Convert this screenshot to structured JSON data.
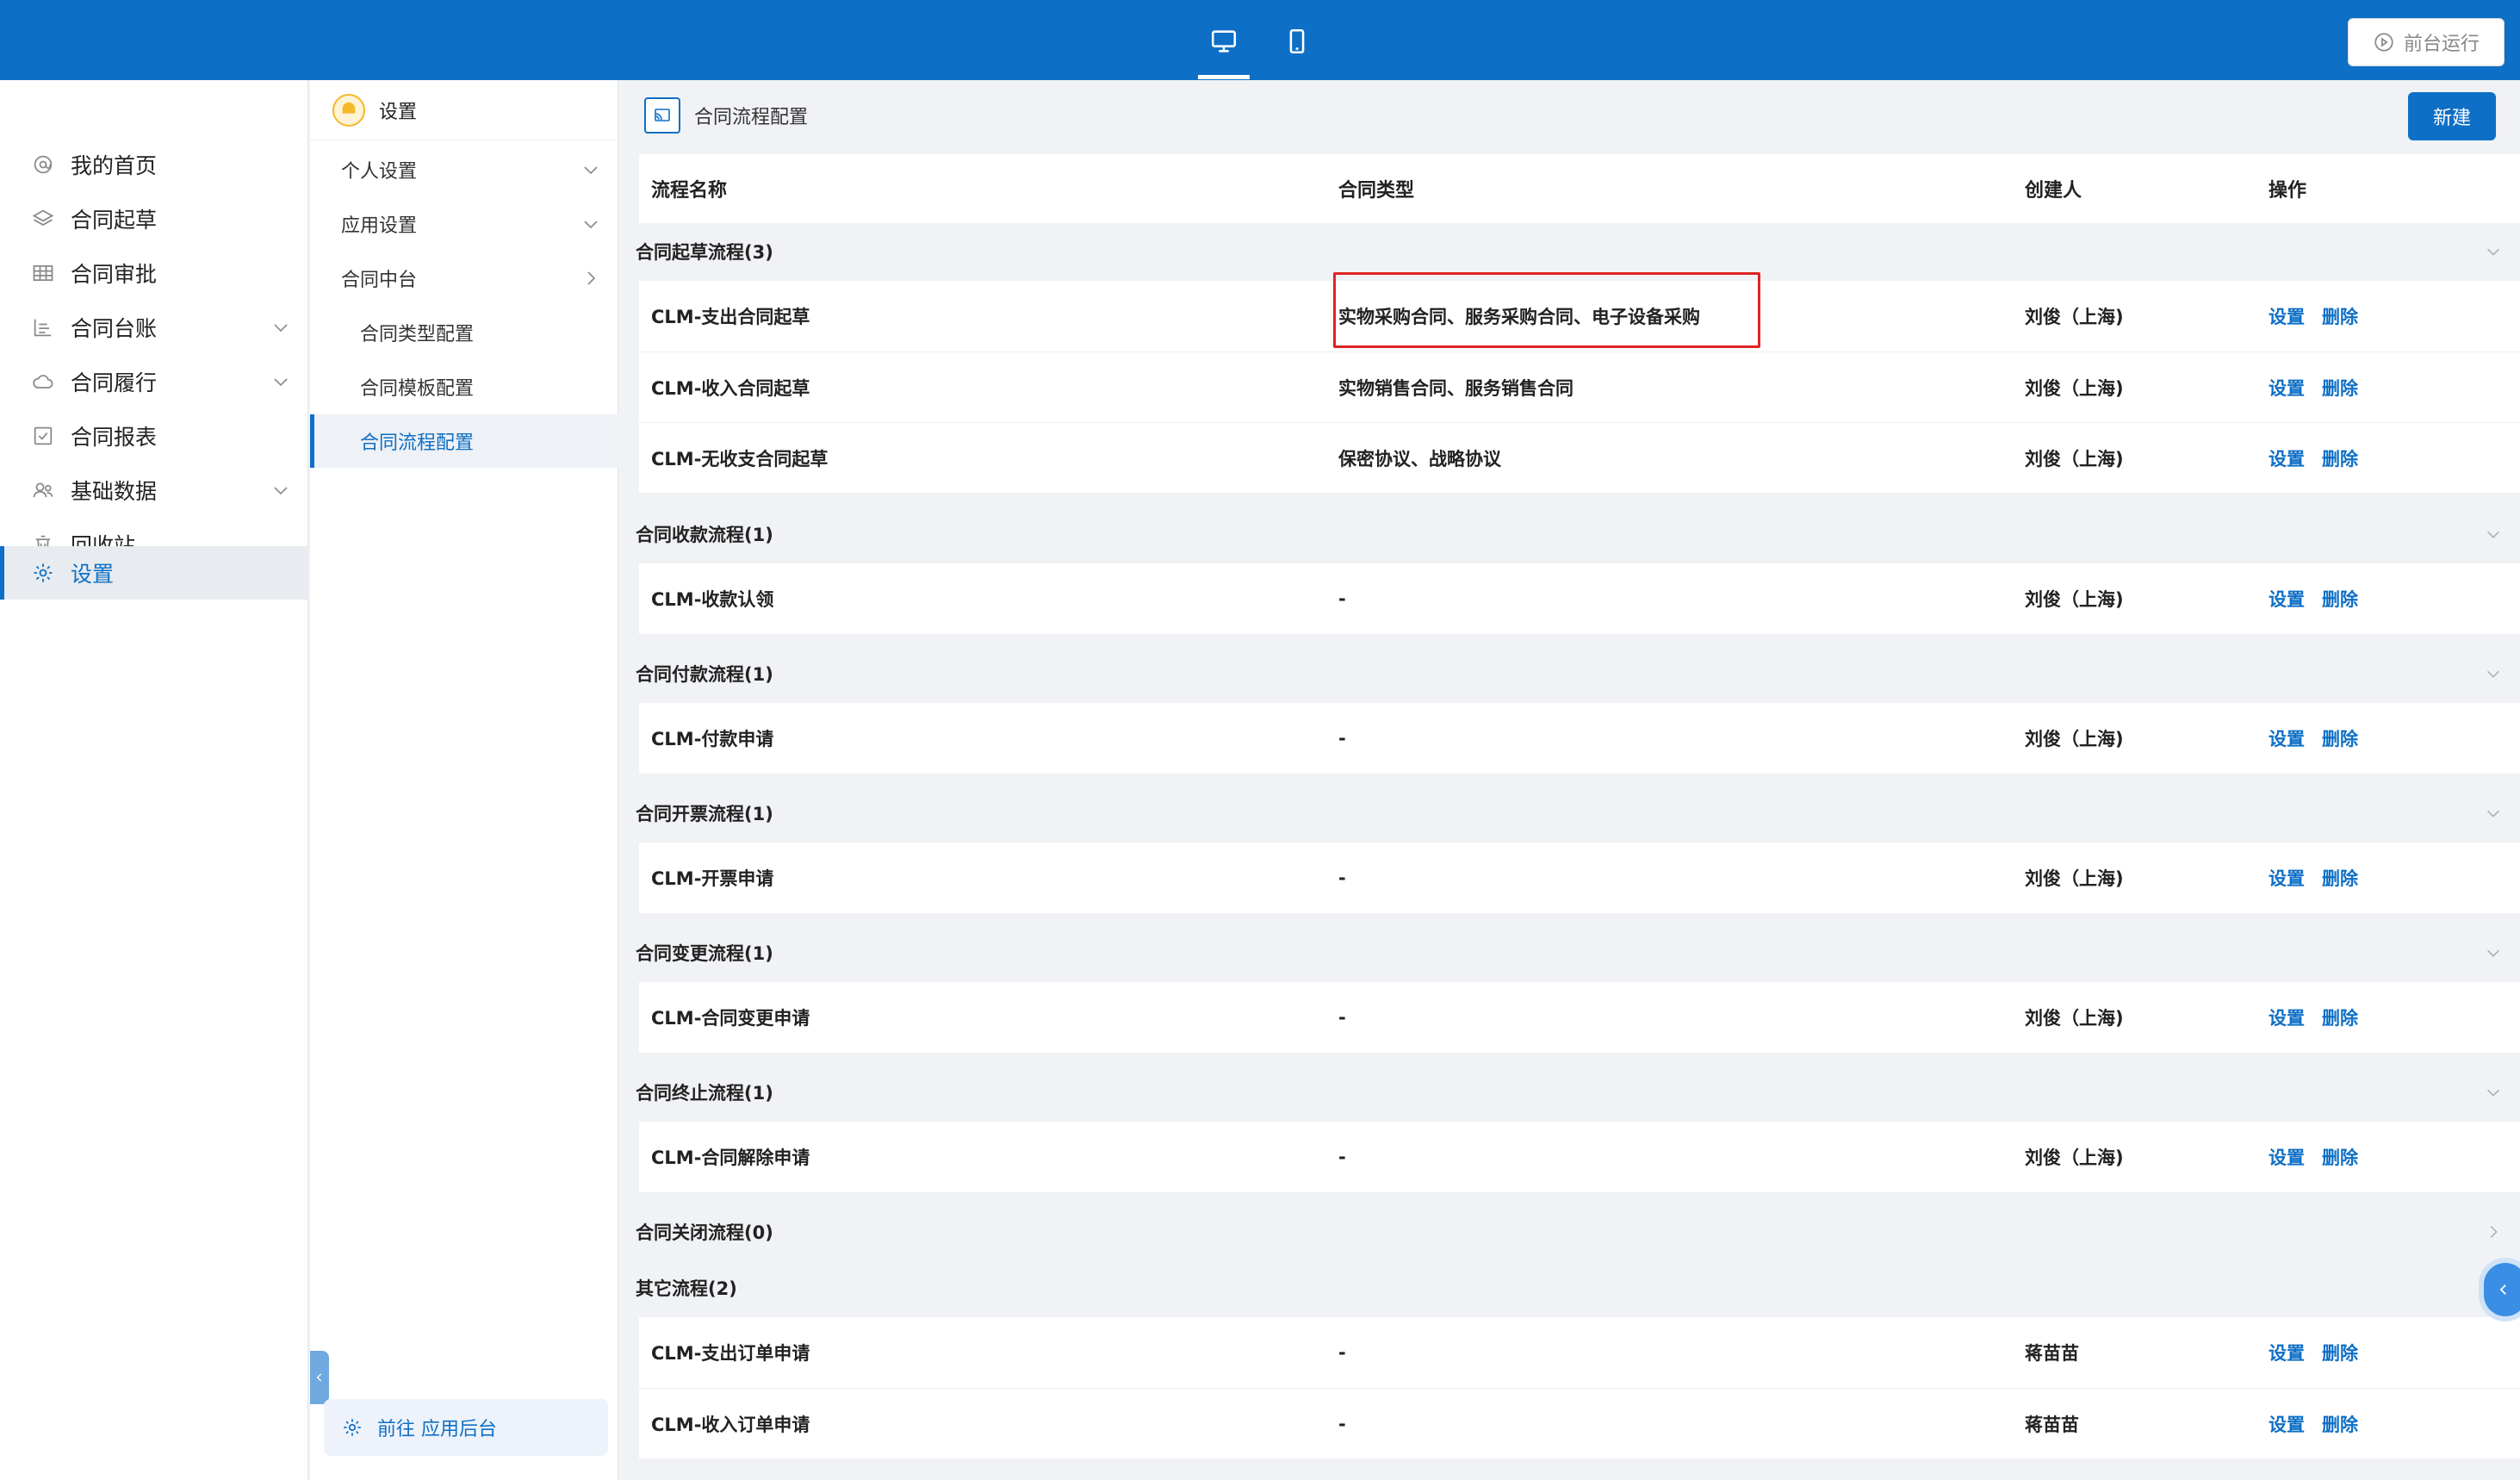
{
  "topbar": {
    "run_label": "前台运行",
    "device_desktop": "desktop-icon",
    "device_mobile": "mobile-icon"
  },
  "leftnav": {
    "items": [
      {
        "label": "我的首页",
        "icon": "at-icon"
      },
      {
        "label": "合同起草",
        "icon": "layers-icon"
      },
      {
        "label": "合同审批",
        "icon": "table-icon"
      },
      {
        "label": "合同台账",
        "icon": "list-icon"
      },
      {
        "label": "合同履行",
        "icon": "cloud-icon"
      },
      {
        "label": "合同报表",
        "icon": "check-square-icon"
      },
      {
        "label": "基础数据",
        "icon": "people-icon"
      },
      {
        "label": "回收站",
        "icon": "trash-icon"
      },
      {
        "label": "设置",
        "icon": "gear-icon"
      }
    ]
  },
  "subpanel": {
    "title": "设置",
    "items": [
      {
        "label": "个人设置"
      },
      {
        "label": "应用设置"
      },
      {
        "label": "合同中台"
      },
      {
        "label": "合同类型配置"
      },
      {
        "label": "合同模板配置"
      },
      {
        "label": "合同流程配置"
      }
    ],
    "goto_backend": "前往 应用后台"
  },
  "main": {
    "title": "合同流程配置",
    "new_button": "新建",
    "columns": [
      "流程名称",
      "合同类型",
      "创建人",
      "操作"
    ],
    "op_set": "设置",
    "op_delete": "删除",
    "groups": [
      {
        "title": "合同起草流程(3)",
        "rows": [
          {
            "name": "CLM-支出合同起草",
            "type": "实物采购合同、服务采购合同、电子设备采购",
            "creator": "刘俊（上海)"
          },
          {
            "name": "CLM-收入合同起草",
            "type": "实物销售合同、服务销售合同",
            "creator": "刘俊（上海)"
          },
          {
            "name": "CLM-无收支合同起草",
            "type": "保密协议、战略协议",
            "creator": "刘俊（上海)"
          }
        ]
      },
      {
        "title": "合同收款流程(1)",
        "rows": [
          {
            "name": "CLM-收款认领",
            "type": "-",
            "creator": "刘俊（上海)"
          }
        ]
      },
      {
        "title": "合同付款流程(1)",
        "rows": [
          {
            "name": "CLM-付款申请",
            "type": "-",
            "creator": "刘俊（上海)"
          }
        ]
      },
      {
        "title": "合同开票流程(1)",
        "rows": [
          {
            "name": "CLM-开票申请",
            "type": "-",
            "creator": "刘俊（上海)"
          }
        ]
      },
      {
        "title": "合同变更流程(1)",
        "rows": [
          {
            "name": "CLM-合同变更申请",
            "type": "-",
            "creator": "刘俊（上海)"
          }
        ]
      },
      {
        "title": "合同终止流程(1)",
        "rows": [
          {
            "name": "CLM-合同解除申请",
            "type": "-",
            "creator": "刘俊（上海)"
          }
        ]
      },
      {
        "title": "合同关闭流程(0)",
        "rows": []
      },
      {
        "title": "其它流程(2)",
        "rows": [
          {
            "name": "CLM-支出订单申请",
            "type": "-",
            "creator": "蒋苗苗"
          },
          {
            "name": "CLM-收入订单申请",
            "type": "-",
            "creator": "蒋苗苗"
          }
        ]
      }
    ]
  },
  "colors": {
    "brand": "#0e6fc6",
    "highlight": "#e02424"
  }
}
